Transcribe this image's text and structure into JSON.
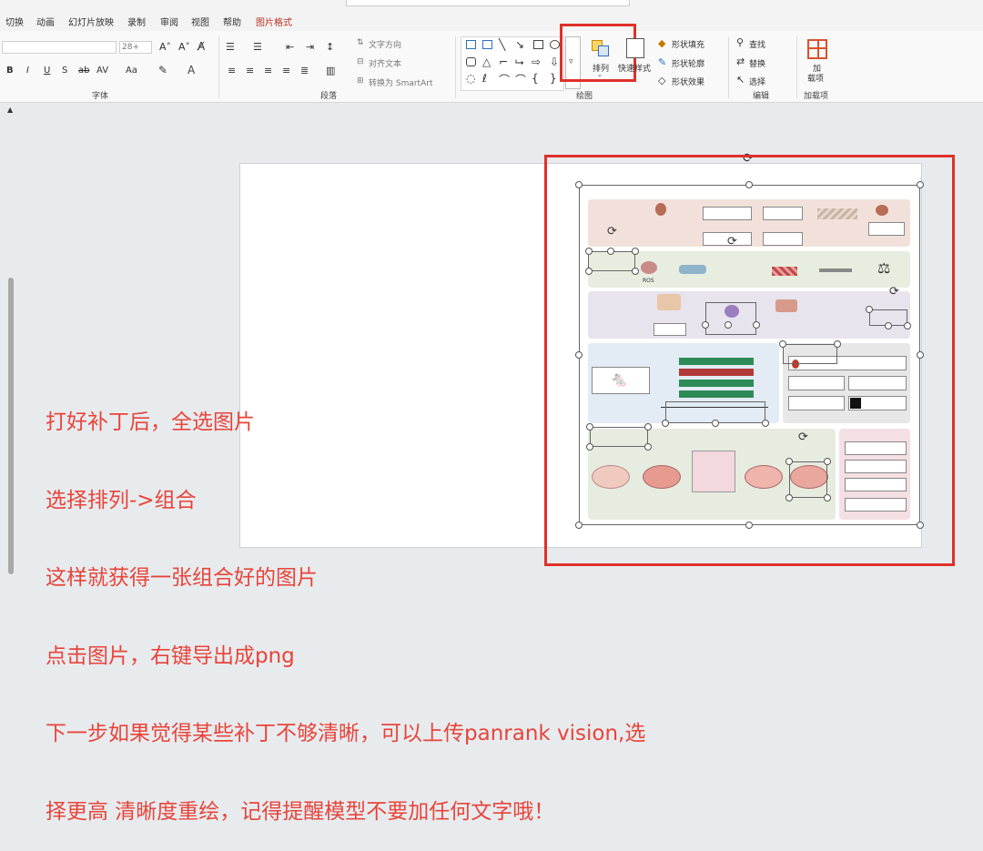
{
  "ribbon": {
    "tabs": [
      "切换",
      "动画",
      "幻灯片放映",
      "录制",
      "审阅",
      "视图",
      "帮助",
      "图片格式"
    ],
    "active_tab": "图片格式",
    "font_size_value": "28+",
    "font_group_label": "字体",
    "paragraph_group_label": "段落",
    "text_direction_label": "文字方向",
    "align_text_label": "对齐文本",
    "convert_smartart_label": "转换为 SmartArt",
    "drawing_group_label": "绘图",
    "arrange_label": "排列",
    "quick_styles_label": "快速样式",
    "shape_fill_label": "形状填充",
    "shape_outline_label": "形状轮廓",
    "shape_effects_label": "形状效果",
    "find_label": "查找",
    "replace_label": "替换",
    "select_label": "选择",
    "editing_group_label": "编辑",
    "addin_label_1": "加",
    "addin_label_2": "载项",
    "addins_group_label": "加载项",
    "font_buttons": [
      "B",
      "I",
      "U",
      "S",
      "ab",
      "AV",
      "Aa"
    ]
  },
  "figure": {
    "mini_label": "ROS"
  },
  "annotation": {
    "lines": [
      "打好补丁后，全选图片",
      "选择排列->组合",
      "这样就获得一张组合好的图片",
      "点击图片，右键导出成png",
      "下一步如果觉得某些补丁不够清晰，可以上传panrank vision,选",
      "择更高 清晰度重绘，记得提醒模型不要加任何文字哦！"
    ]
  },
  "colors": {
    "highlight_red": "#e0302a",
    "annotation_red": "#e8443a",
    "active_tab": "#c03020"
  }
}
